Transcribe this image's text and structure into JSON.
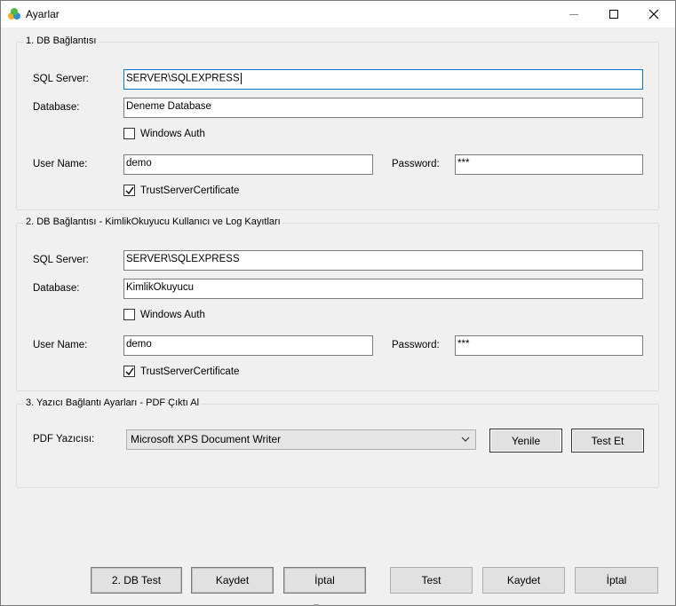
{
  "window": {
    "title": "Ayarlar",
    "app_icon": "settings-app-icon"
  },
  "section1": {
    "legend": "1. DB Bağlantısı",
    "server_label": "SQL Server:",
    "server_value": "SERVER\\SQLEXPRESS",
    "database_label": "Database:",
    "database_value": "Deneme Database",
    "windows_auth_label": "Windows Auth",
    "windows_auth_checked": false,
    "user_label": "User Name:",
    "user_value": "demo",
    "password_label": "Password:",
    "password_value": "***",
    "trust_label": "TrustServerCertificate",
    "trust_checked": true
  },
  "section2": {
    "legend": "2. DB Bağlantısı - KimlikOkuyucu Kullanıcı ve Log Kayıtları",
    "server_label": "SQL Server:",
    "server_value": "SERVER\\SQLEXPRESS",
    "database_label": "Database:",
    "database_value": "KimlikOkuyucu",
    "windows_auth_label": "Windows Auth",
    "windows_auth_checked": false,
    "user_label": "User Name:",
    "user_value": "demo",
    "password_label": "Password:",
    "password_value": "***",
    "trust_label": "TrustServerCertificate",
    "trust_checked": true
  },
  "section3": {
    "legend": "3. Yazıcı Bağlantı Ayarları - PDF Çıktı Al",
    "printer_label": "PDF Yazıcısı:",
    "printer_value": "Microsoft XPS Document Writer",
    "refresh_label": "Yenile",
    "test_label": "Test Et"
  },
  "footer": {
    "db2_test_label": "2. DB Test",
    "save_left_label": "Kaydet",
    "cancel_left_label": "İptal",
    "test_label": "Test",
    "save_right_label": "Kaydet",
    "cancel_right_label": "İptal"
  }
}
